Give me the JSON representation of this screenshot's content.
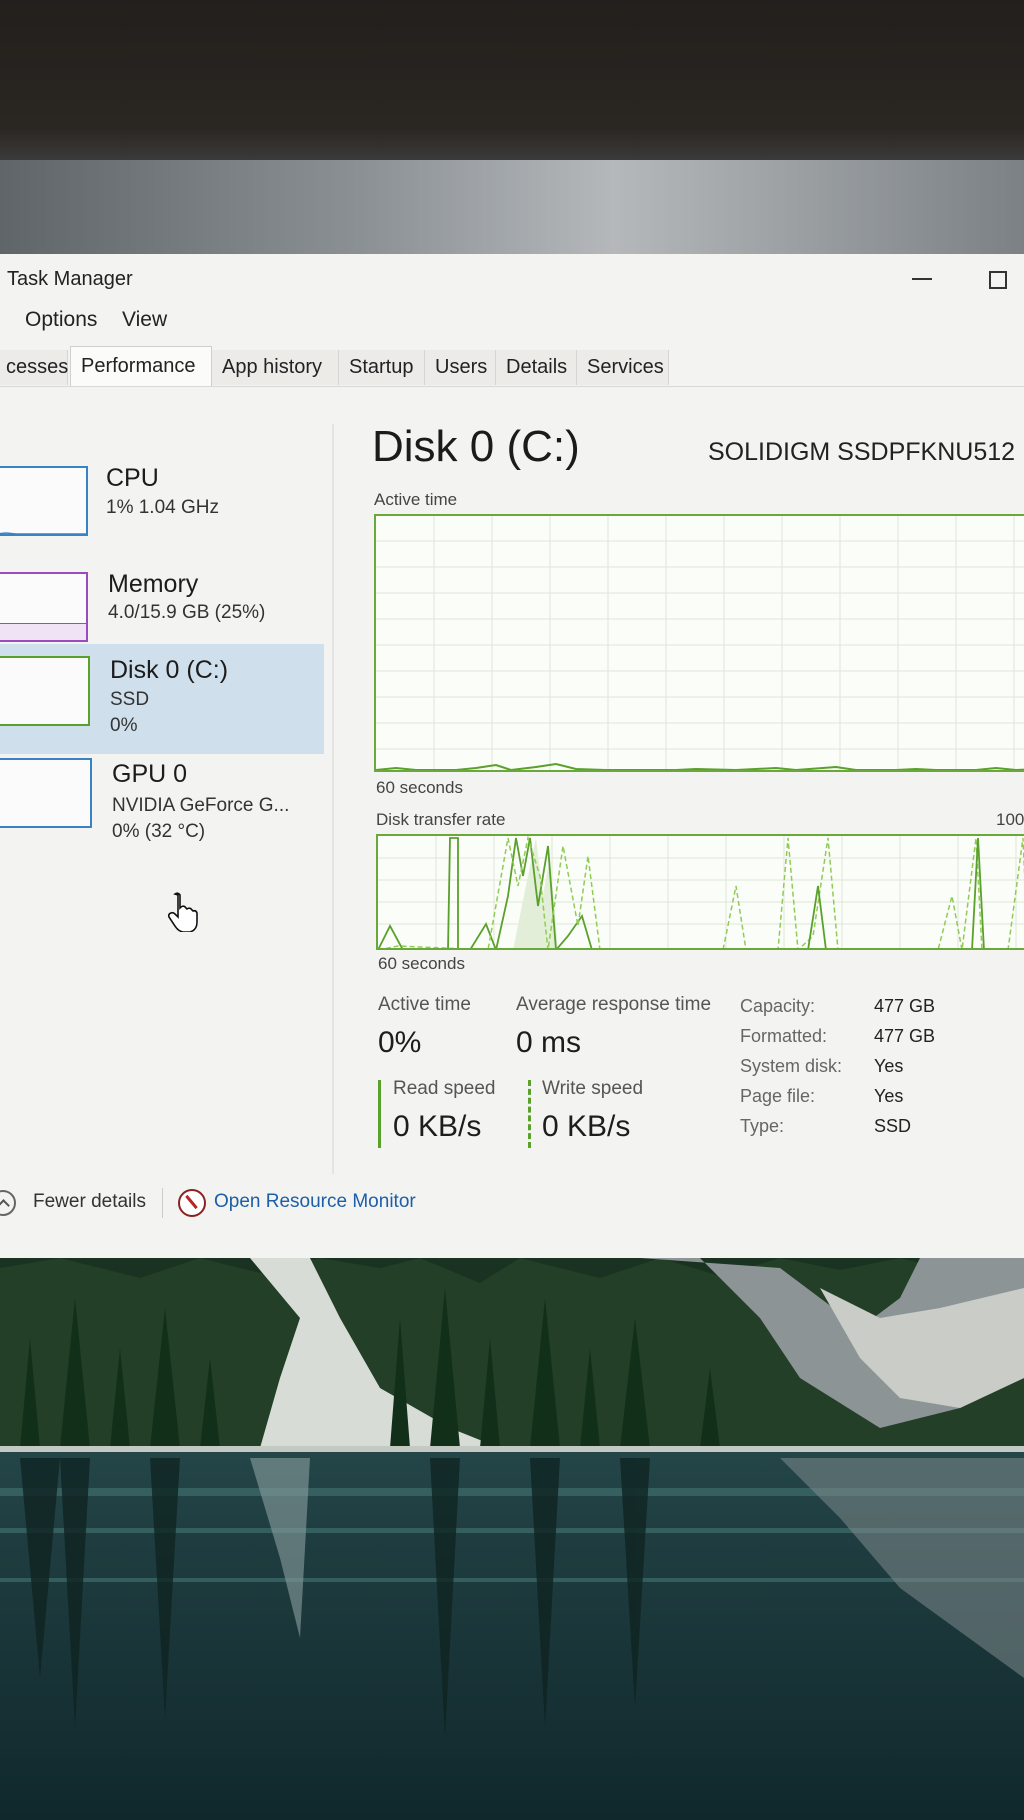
{
  "window": {
    "title": "Task Manager"
  },
  "menu": {
    "items": [
      "Options",
      "View"
    ]
  },
  "tabs": [
    "cesses",
    "Performance",
    "App history",
    "Startup",
    "Users",
    "Details",
    "Services"
  ],
  "active_tab": "Performance",
  "sidebar": {
    "items": [
      {
        "name": "CPU",
        "line1": "1% 1.04 GHz",
        "line2": "",
        "color": "#3b82c4"
      },
      {
        "name": "Memory",
        "line1": "4.0/15.9 GB (25%)",
        "line2": "",
        "color": "#9a4bbf"
      },
      {
        "name": "Disk 0 (C:)",
        "line1": "SSD",
        "line2": "0%",
        "color": "#5aa02c",
        "selected": true
      },
      {
        "name": "GPU 0",
        "line1": "NVIDIA GeForce G...",
        "line2": "0% (32 °C)",
        "color": "#3b82c4"
      }
    ]
  },
  "main": {
    "title": "Disk 0 (C:)",
    "model": "SOLIDIGM SSDPFKNU512",
    "active_chart": {
      "label": "Active time",
      "footer": "60 seconds"
    },
    "transfer_chart": {
      "label": "Disk transfer rate",
      "right_label": "100",
      "footer": "60 seconds"
    },
    "stats": {
      "active_time_label": "Active time",
      "active_time_value": "0%",
      "avg_response_label": "Average response time",
      "avg_response_value": "0 ms",
      "read_speed_label": "Read speed",
      "read_speed_value": "0 KB/s",
      "write_speed_label": "Write speed",
      "write_speed_value": "0 KB/s"
    },
    "properties": [
      {
        "key": "Capacity:",
        "value": "477 GB"
      },
      {
        "key": "Formatted:",
        "value": "477 GB"
      },
      {
        "key": "System disk:",
        "value": "Yes"
      },
      {
        "key": "Page file:",
        "value": "Yes"
      },
      {
        "key": "Type:",
        "value": "SSD"
      }
    ]
  },
  "footer": {
    "fewer_details": "Fewer details",
    "open_resource_monitor": "Open Resource Monitor"
  },
  "colors": {
    "disk_green": "#5aa02c",
    "selection": "#cfe0ec",
    "link": "#1c5fa8"
  }
}
